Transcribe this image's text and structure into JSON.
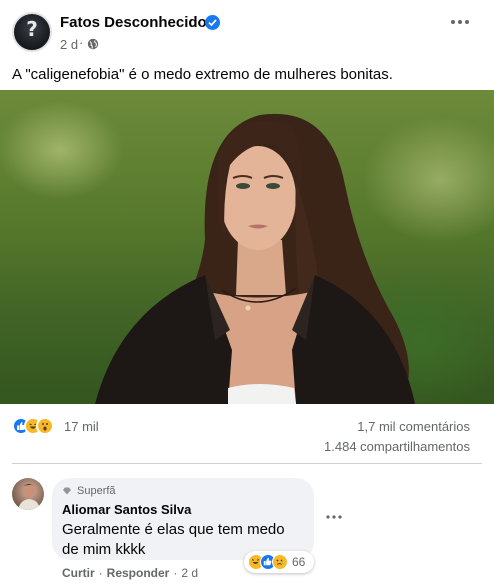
{
  "post": {
    "page_name": "Fatos Desconhecidos",
    "time": "2 d",
    "dot": "·",
    "text": "A \"caligenefobia\" é o medo extremo de mulheres bonitas.",
    "reaction_count": "17 mil",
    "comments_count": "1,7 mil comentários",
    "shares_count": "1.484 compartilhamentos",
    "reactions": [
      "like-icon",
      "haha-icon",
      "wow-icon"
    ]
  },
  "comment": {
    "badge": "Superfã",
    "author": "Aliomar Santos Silva",
    "text": "Geralmente é elas que tem medo de mim kkkk",
    "reaction_count": "66",
    "reactions": [
      "haha-icon",
      "like-icon",
      "sad-icon"
    ],
    "actions": {
      "like": "Curtir",
      "reply": "Responder",
      "time": "2 d",
      "dot": "·"
    }
  },
  "colors": {
    "brand_blue": "#1877f2",
    "secondary_text": "#65676b",
    "bubble_bg": "#f0f2f5"
  }
}
